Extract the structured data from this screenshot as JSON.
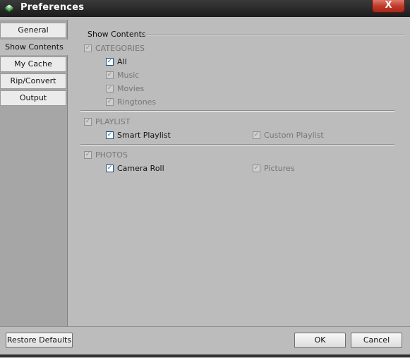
{
  "window": {
    "title": "Preferences",
    "close_glyph": "X"
  },
  "nav": {
    "items": [
      {
        "label": "General"
      },
      {
        "label": "Show Contents"
      },
      {
        "label": "My Cache"
      },
      {
        "label": "Rip/Convert"
      },
      {
        "label": "Output"
      }
    ]
  },
  "show_contents": {
    "title": "Show Contents",
    "categories": {
      "label": "CATEGORIES",
      "checked": true,
      "options": [
        {
          "label": "All",
          "checked": true,
          "enabled": true
        },
        {
          "label": "Music",
          "checked": true,
          "enabled": false
        },
        {
          "label": "Movies",
          "checked": true,
          "enabled": false
        },
        {
          "label": "Ringtones",
          "checked": true,
          "enabled": false
        }
      ]
    },
    "playlist": {
      "label": "PLAYLIST",
      "checked": true,
      "options": [
        {
          "label": "Smart Playlist",
          "checked": true,
          "enabled": true
        },
        {
          "label": "Custom Playlist",
          "checked": true,
          "enabled": false
        }
      ]
    },
    "photos": {
      "label": "PHOTOS",
      "checked": true,
      "options": [
        {
          "label": "Camera Roll",
          "checked": true,
          "enabled": true
        },
        {
          "label": "Pictures",
          "checked": true,
          "enabled": false
        }
      ]
    }
  },
  "footer": {
    "restore_label": "Restore Defaults",
    "ok_label": "OK",
    "cancel_label": "Cancel"
  },
  "check_glyph": "✓"
}
